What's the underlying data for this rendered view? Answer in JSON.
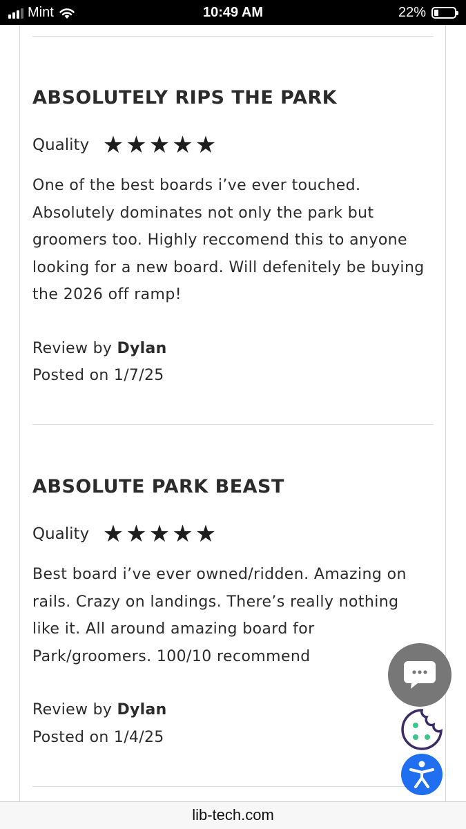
{
  "status_bar": {
    "carrier": "Mint",
    "time": "10:49 AM",
    "battery_percent": "22%",
    "battery_level": 0.22,
    "signal_bars": 3,
    "icons": [
      "signal-icon",
      "wifi-icon",
      "battery-icon"
    ]
  },
  "reviews": [
    {
      "title": "ABSOLUTELY RIPS THE PARK",
      "rating_label": "Quality",
      "rating": 5,
      "body": "One of the best boards i’ve ever touched. Absolutely dominates not only the park but groomers too. Highly reccomend this to anyone looking for a new board. Will defenitely be buying the 2026 off ramp!",
      "review_by_label": "Review by",
      "author": "Dylan",
      "posted_label": "Posted on 1/7/25"
    },
    {
      "title": "ABSOLUTE PARK BEAST",
      "rating_label": "Quality",
      "rating": 5,
      "body": "Best board i’ve ever owned/ridden. Amazing on rails. Crazy on landings. There’s really nothing like it. All around amazing board for Park/groomers. 100/10 recommend",
      "review_by_label": "Review by",
      "author": "Dylan",
      "posted_label": "Posted on 1/4/25"
    }
  ],
  "floating_buttons": {
    "chat_icon": "chat-bubble-icon",
    "cookie_icon": "cookie-icon",
    "accessibility_icon": "accessibility-icon"
  },
  "colors": {
    "chat_button": "#777777",
    "cookie_outline": "#3b2a66",
    "cookie_dots": "#3fc48a",
    "accessibility_button": "#1f6ff0"
  },
  "url_bar": {
    "url": "lib-tech.com"
  }
}
